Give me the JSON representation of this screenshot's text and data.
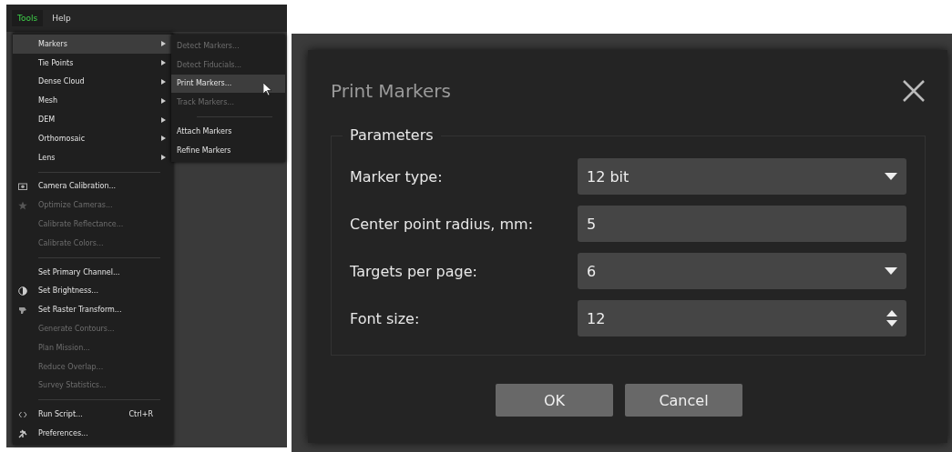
{
  "menubar": [
    {
      "label": "Tools",
      "selected": true
    },
    {
      "label": "Help",
      "selected": false
    }
  ],
  "menu": [
    {
      "kind": "submenu",
      "label": "Markers",
      "selected": true,
      "disabled": false
    },
    {
      "kind": "submenu",
      "label": "Tie Points",
      "selected": false,
      "disabled": false
    },
    {
      "kind": "submenu",
      "label": "Dense Cloud",
      "selected": false,
      "disabled": false
    },
    {
      "kind": "submenu",
      "label": "Mesh",
      "selected": false,
      "disabled": false
    },
    {
      "kind": "submenu",
      "label": "DEM",
      "selected": false,
      "disabled": false
    },
    {
      "kind": "submenu",
      "label": "Orthomosaic",
      "selected": false,
      "disabled": false
    },
    {
      "kind": "submenu",
      "label": "Lens",
      "selected": false,
      "disabled": false
    },
    {
      "kind": "separator"
    },
    {
      "kind": "item",
      "label": "Camera Calibration...",
      "selected": false,
      "disabled": false
    },
    {
      "kind": "item",
      "label": "Optimize Cameras...",
      "selected": false,
      "disabled": true
    },
    {
      "kind": "item",
      "label": "Calibrate Reflectance...",
      "selected": false,
      "disabled": true
    },
    {
      "kind": "item",
      "label": "Calibrate Colors...",
      "selected": false,
      "disabled": true
    },
    {
      "kind": "separator"
    },
    {
      "kind": "item",
      "label": "Set Primary Channel...",
      "selected": false,
      "disabled": false
    },
    {
      "kind": "item",
      "label": "Set Brightness...",
      "selected": false,
      "disabled": false
    },
    {
      "kind": "item",
      "label": "Set Raster Transform...",
      "selected": false,
      "disabled": false
    },
    {
      "kind": "item",
      "label": "Generate Contours...",
      "selected": false,
      "disabled": true
    },
    {
      "kind": "item",
      "label": "Plan Mission...",
      "selected": false,
      "disabled": true
    },
    {
      "kind": "item",
      "label": "Reduce Overlap...",
      "selected": false,
      "disabled": true
    },
    {
      "kind": "item",
      "label": "Survey Statistics...",
      "selected": false,
      "disabled": true
    },
    {
      "kind": "separator"
    },
    {
      "kind": "item",
      "label": "Run Script...",
      "shortcut": "Ctrl+R",
      "selected": false,
      "disabled": false
    },
    {
      "kind": "item",
      "label": "Preferences...",
      "selected": false,
      "disabled": false
    }
  ],
  "submenu": [
    {
      "kind": "item",
      "label": "Detect Markers...",
      "selected": false,
      "disabled": true
    },
    {
      "kind": "item",
      "label": "Detect Fiducials...",
      "selected": false,
      "disabled": true
    },
    {
      "kind": "item",
      "label": "Print Markers...",
      "selected": true,
      "disabled": false
    },
    {
      "kind": "item",
      "label": "Track Markers...",
      "selected": false,
      "disabled": true
    },
    {
      "kind": "separator"
    },
    {
      "kind": "item",
      "label": "Attach Markers",
      "selected": false,
      "disabled": false
    },
    {
      "kind": "item",
      "label": "Refine Markers",
      "selected": false,
      "disabled": false
    }
  ],
  "dialog": {
    "title": "Print Markers",
    "group": "Parameters",
    "fields": [
      {
        "kind": "dropdown",
        "label": "Marker type:",
        "value": "12 bit"
      },
      {
        "kind": "text",
        "label": "Center point radius, mm:",
        "value": "5"
      },
      {
        "kind": "dropdown",
        "label": "Targets per page:",
        "value": "6"
      },
      {
        "kind": "spinbox",
        "label": "Font size:",
        "value": "12"
      }
    ],
    "buttons": [
      "OK",
      "Cancel"
    ]
  }
}
